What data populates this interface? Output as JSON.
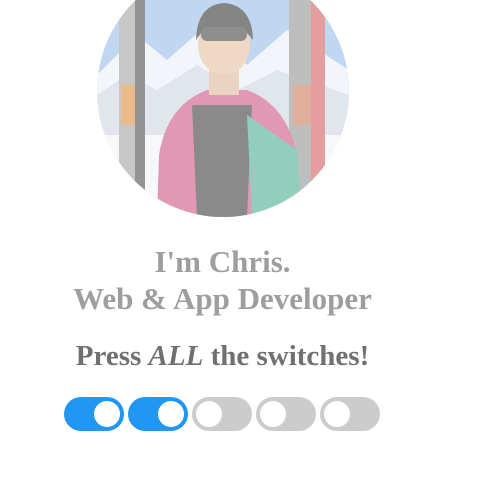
{
  "profile": {
    "avatar_icon": "profile-photo-skier",
    "intro_line1": "I'm Chris.",
    "intro_line2": "Web & App Developer"
  },
  "cta": {
    "before": "Press ",
    "emphasis": "ALL",
    "after": " the switches!"
  },
  "switches": [
    {
      "on": true
    },
    {
      "on": true
    },
    {
      "on": false
    },
    {
      "on": false
    },
    {
      "on": false
    }
  ],
  "colors": {
    "switch_on": "#2196f3",
    "switch_off": "#cccccc",
    "intro_text": "#9e9e9e",
    "cta_text": "#707070"
  }
}
